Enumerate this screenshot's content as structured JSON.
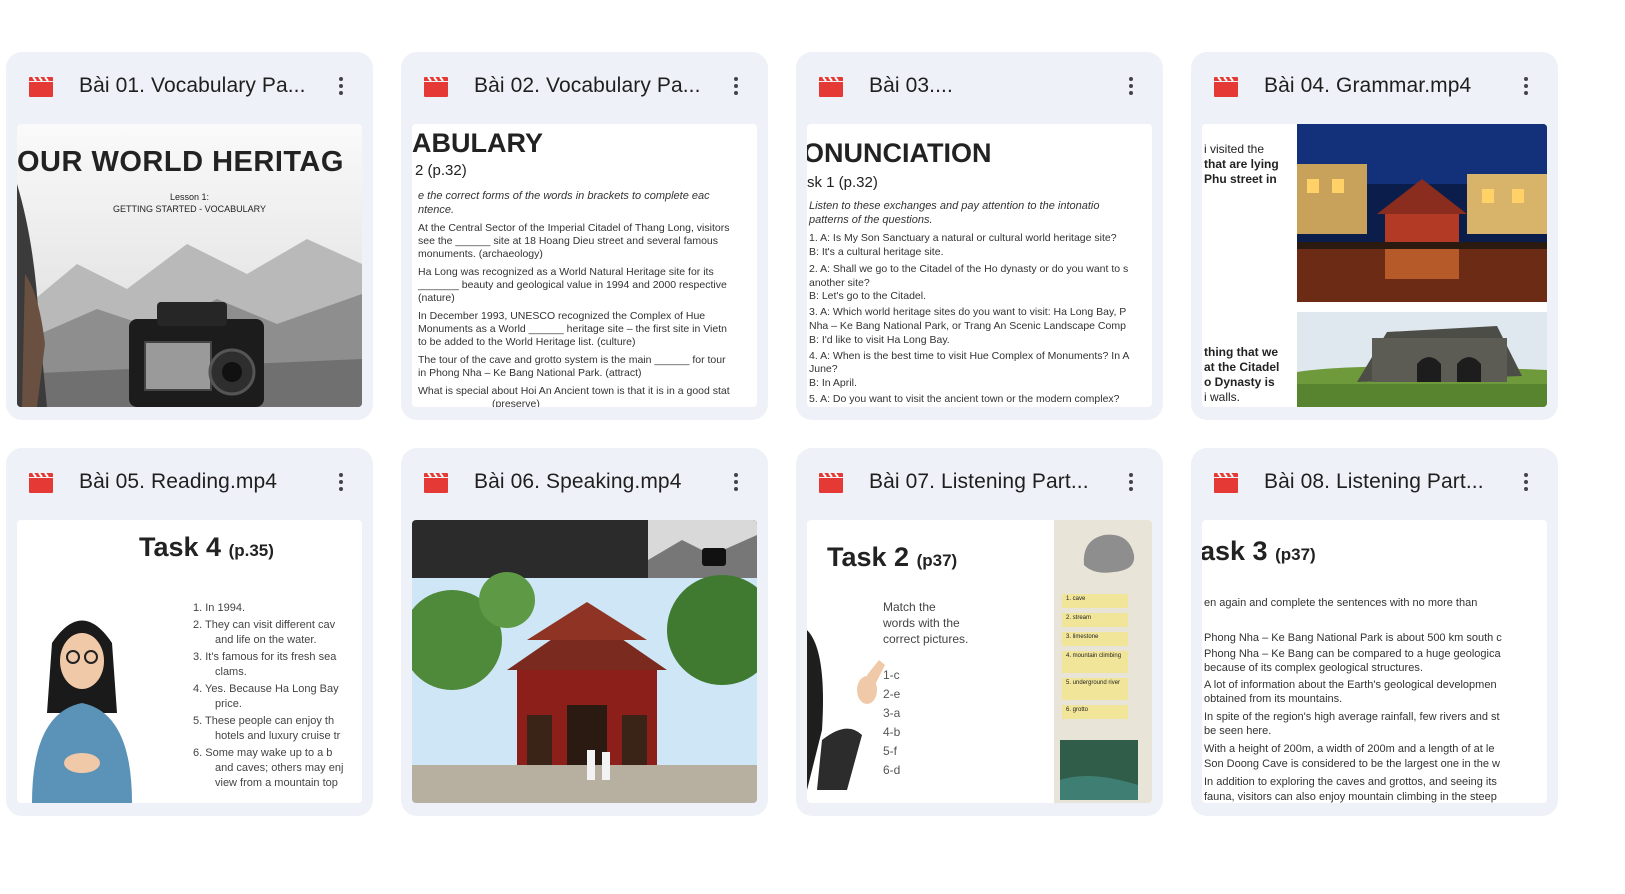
{
  "colors": {
    "card_bg": "#eef1f7",
    "video_icon": "#e53935",
    "text": "#1f1f1f"
  },
  "cards": [
    {
      "title": "Bài 01. Vocabulary Pa...",
      "icon": "video-file-icon",
      "thumb": {
        "heading": "OUR WORLD HERITAG",
        "sub1": "Lesson 1:",
        "sub2": "GETTING STARTED - VOCABULARY"
      }
    },
    {
      "title": "Bài 02. Vocabulary Pa...",
      "icon": "video-file-icon",
      "thumb": {
        "heading": "ABULARY",
        "task": "2 (p.32)",
        "lines": [
          "e the correct forms of the words in brackets to complete eac",
          "ntence.",
          "At the Central Sector of the Imperial Citadel of Thang Long, visitors",
          "see the ______ site at 18 Hoang Dieu street and several famous",
          "monuments. (archaeology)",
          "Ha Long was recognized as a World Natural Heritage site for its",
          "_______ beauty and geological value in 1994 and 2000 respective",
          "(nature)",
          "In December 1993, UNESCO recognized the Complex of Hue",
          "Monuments as a World ______ heritage site – the first site in Vietn",
          "to be added to the World Heritage list. (culture)",
          "The tour of the cave and grotto system is the main ______ for tour",
          "in Phong Nha – Ke Bang National Park. (attract)",
          "What is special about Hoi An Ancient town is that it is in a good stat",
          "(preserve)"
        ]
      }
    },
    {
      "title": "Bài 03....",
      "icon": "video-file-icon",
      "thumb": {
        "heading": "ONUNCIATION",
        "task": "sk 1 (p.32)",
        "lines": [
          "Listen to these exchanges and pay attention to the intonatio",
          "patterns of the questions.",
          "1. A: Is My Son Sanctuary a natural or cultural world heritage site?",
          "    B: It's a cultural heritage site.",
          "2. A: Shall we go to the Citadel of the Ho dynasty or do you want to s",
          "another site?",
          "    B: Let's go to the Citadel.",
          "3. A: Which world heritage sites do you want to visit: Ha Long Bay, P",
          "Nha – Ke Bang National Park, or Trang An Scenic Landscape Comp",
          "    B: I'd like to visit Ha Long Bay.",
          "4. A: When is the best time to visit Hue Complex of Monuments? In A",
          "June?",
          "    B: In April.",
          "5. A: Do you want to visit the ancient town or the modern complex?"
        ]
      }
    },
    {
      "title": "Bài 04. Grammar.mp4",
      "icon": "video-file-icon",
      "thumb": {
        "top_lines": [
          "i visited the",
          "that are lying",
          "Phu street in"
        ],
        "bottom_lines": [
          "thing that we",
          "at the Citadel",
          "o Dynasty is",
          "i walls."
        ]
      }
    },
    {
      "title": "Bài 05. Reading.mp4",
      "icon": "video-file-icon",
      "thumb": {
        "task": "Task 4",
        "page": "(p.35)",
        "items": [
          [
            "1.",
            "In 1994."
          ],
          [
            "2.",
            "They can visit different cav",
            "and life on the water."
          ],
          [
            "3.",
            "It's famous for its fresh sea",
            "clams."
          ],
          [
            "4.",
            "Yes. Because Ha Long Bay",
            "price."
          ],
          [
            "5.",
            "These people can enjoy th",
            "hotels and luxury cruise tr"
          ],
          [
            "6.",
            "Some may wake up to a b",
            "and caves; others may enj",
            "view from a mountain top"
          ]
        ]
      }
    },
    {
      "title": "Bài 06. Speaking.mp4",
      "icon": "video-file-icon",
      "thumb": {}
    },
    {
      "title": "Bài 07. Listening Part...",
      "icon": "video-file-icon",
      "thumb": {
        "task": "Task 2",
        "page": "(p37)",
        "instr": [
          "Match the",
          "words with the",
          "correct pictures."
        ],
        "answers": [
          "1-c",
          "2-e",
          "3-a",
          "4-b",
          "5-f",
          "6-d"
        ],
        "labels": [
          "1. cave",
          "2. stream",
          "3. limestone",
          "4. mountain climbing",
          "5. underground river",
          "6. grotto"
        ]
      }
    },
    {
      "title": "Bài 08. Listening Part...",
      "icon": "video-file-icon",
      "thumb": {
        "task": "ask 3",
        "page": "(p37)",
        "lines": [
          "en again and complete the sentences with no more than",
          "Phong Nha – Ke Bang National Park is about 500 km south c",
          "Phong Nha – Ke Bang can be compared to a huge geologica",
          "because of its complex geological structures.",
          "A lot of information about the Earth's geological developmen",
          "obtained from its mountains.",
          "In spite of the region's high average rainfall, few rivers and st",
          "be seen here.",
          "With a height of 200m, a width of 200m and a length of at le",
          "Son Doong Cave is considered to be the largest one in the w",
          "In addition to exploring the caves and grottos, and seeing its",
          "fauna, visitors can also enjoy mountain climbing in the steep"
        ]
      }
    }
  ]
}
